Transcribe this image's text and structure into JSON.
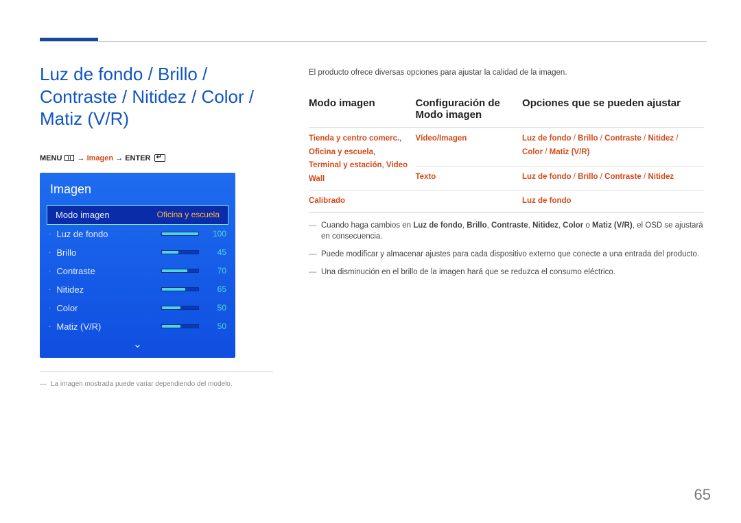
{
  "page_number": "65",
  "title": "Luz de fondo / Brillo / Contraste / Nitidez / Color / Matiz (V/R)",
  "menu_path": {
    "menu": "MENU",
    "arrow": "→",
    "step1": "Imagen",
    "step2": "ENTER"
  },
  "osd": {
    "title": "Imagen",
    "current_mode_label": "Modo imagen",
    "current_mode_value": "Oficina y escuela",
    "items": [
      {
        "label": "Luz de fondo",
        "value": "100",
        "pct": 100
      },
      {
        "label": "Brillo",
        "value": "45",
        "pct": 45
      },
      {
        "label": "Contraste",
        "value": "70",
        "pct": 70
      },
      {
        "label": "Nitidez",
        "value": "65",
        "pct": 65
      },
      {
        "label": "Color",
        "value": "50",
        "pct": 50
      },
      {
        "label": "Matiz (V/R)",
        "value": "50",
        "pct": 50
      }
    ]
  },
  "footnote_panel": "La imagen mostrada puede variar dependiendo del modelo.",
  "intro": "El producto ofrece diversas opciones para ajustar la calidad de la imagen.",
  "table": {
    "headers": {
      "c1": "Modo imagen",
      "c2": "Configuración de Modo imagen",
      "c3": "Opciones que se pueden ajustar"
    },
    "rows": {
      "r1": {
        "c1_parts": [
          "Tienda y centro comerc.",
          ", ",
          "Oficina y escuela",
          ", ",
          "Terminal y estación",
          ", ",
          "Video Wall"
        ],
        "c2a": "Vídeo/Imagen",
        "c2b": "Texto",
        "c3a_parts": [
          "Luz de fondo",
          " / ",
          "Brillo",
          " / ",
          "Contraste",
          " / ",
          "Nitidez",
          " / ",
          "Color",
          " / ",
          "Matiz (V/R)"
        ],
        "c3b_parts": [
          "Luz de fondo",
          " / ",
          "Brillo",
          " / ",
          "Contraste",
          " / ",
          "Nitidez"
        ]
      },
      "r2": {
        "c1": "Calibrado",
        "c2": "",
        "c3": "Luz de fondo"
      }
    }
  },
  "notes": {
    "n1_pre": "Cuando haga cambios en ",
    "n1_bold": [
      "Luz de fondo",
      "Brillo",
      "Contraste",
      "Nitidez",
      "Color",
      "Matiz (V/R)"
    ],
    "n1_sep": ", ",
    "n1_or": " o ",
    "n1_post": ", el OSD se ajustará en consecuencia.",
    "n2": "Puede modificar y almacenar ajustes para cada dispositivo externo que conecte a una entrada del producto.",
    "n3": "Una disminución en el brillo de la imagen hará que se reduzca el consumo eléctrico."
  }
}
